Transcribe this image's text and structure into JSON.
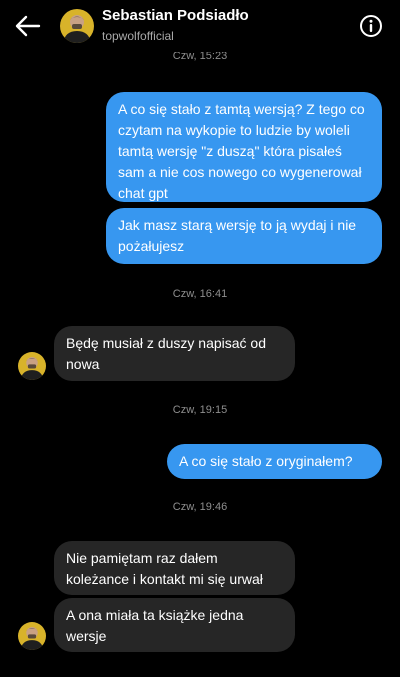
{
  "header": {
    "contact_name": "Sebastian Podsiadło",
    "contact_handle": "topwolfofficial",
    "back_icon": "arrow-left-icon",
    "info_icon": "info-circle-icon"
  },
  "messages": {
    "ts0": "Czw, 15:23",
    "m1": "A co się stało z tamtą wersją? Z tego co czytam na wykopie to ludzie by woleli tamtą wersję \"z duszą\" która pisałeś sam a nie cos nowego co wygenerował chat gpt",
    "m2": "Jak masz starą wersję to ją wydaj i nie pożałujesz",
    "ts1": "Czw, 16:41",
    "m3": "Będę musiał z duszy napisać od nowa",
    "ts2": "Czw, 19:15",
    "m4": "A co się stało z oryginałem?",
    "ts3": "Czw, 19:46",
    "m5": "Nie pamiętam raz dałem koleżance i kontakt mi się urwał",
    "m6": "A ona miała ta książke jedna wersje"
  },
  "colors": {
    "background": "#000000",
    "sent_bubble": "#3797f0",
    "received_bubble": "#262626",
    "timestamp": "#8e8e8e",
    "handle": "#a8a8a8"
  }
}
